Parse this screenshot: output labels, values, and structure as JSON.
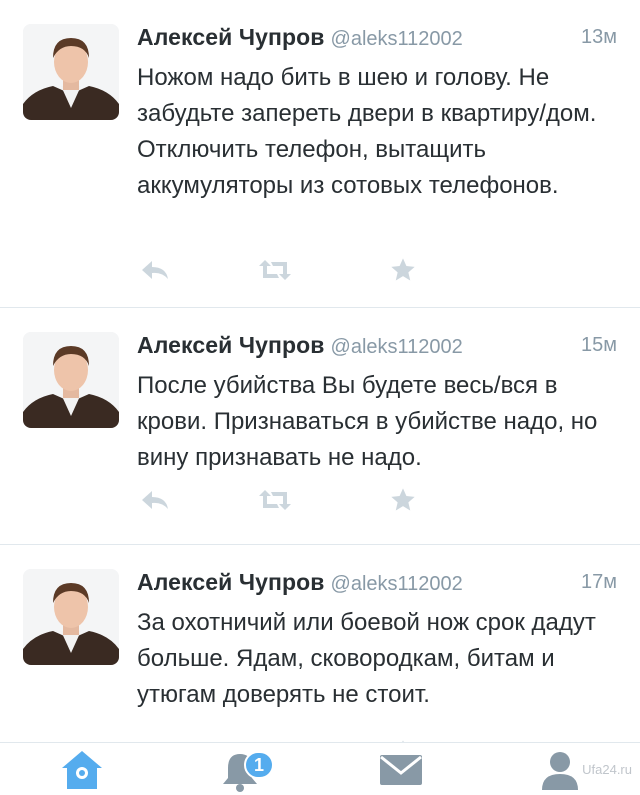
{
  "tweets": [
    {
      "name": "Алексей Чупров",
      "handle": "@aleks112002",
      "time": "13м",
      "text": "Ножом надо бить в шею и голову. Не забудьте запереть двери в квартиру/дом. Отключить телефон, вытащить аккумуляторы из сотовых телефонов."
    },
    {
      "name": "Алексей Чупров",
      "handle": "@aleks112002",
      "time": "15м",
      "text": "После убийства Вы будете весь/вся в крови. Признаваться в убийстве надо, но вину признавать не надо."
    },
    {
      "name": "Алексей Чупров",
      "handle": "@aleks112002",
      "time": "17м",
      "text": "За охотничий или боевой нож срок дадут больше. Ядам, сковородкам, битам и утюгам доверять не стоит."
    }
  ],
  "tabbar": {
    "notifications_badge": "1"
  },
  "watermark": "Ufa24.ru",
  "icons": {
    "reply": "reply-icon",
    "retweet": "retweet-icon",
    "favorite": "star-icon",
    "home": "home-icon",
    "notifications": "bell-icon",
    "messages": "envelope-icon",
    "me": "person-icon"
  },
  "colors": {
    "accent": "#55acee",
    "action_gray": "#ccd6dd",
    "tab_gray": "#8899a6",
    "text": "#292f33",
    "secondary": "#8899a6"
  }
}
